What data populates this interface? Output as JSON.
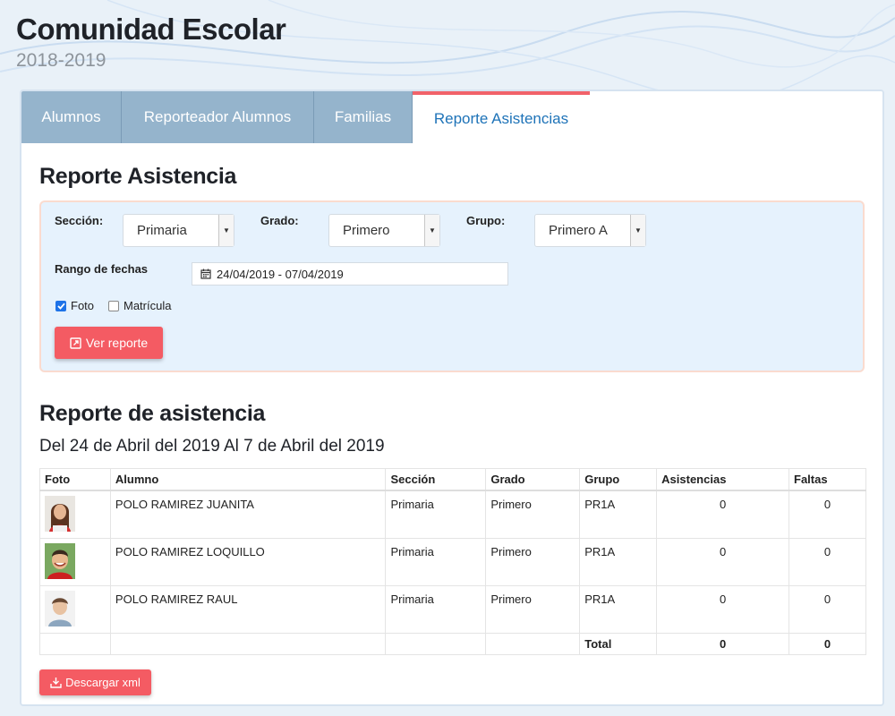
{
  "app": {
    "title": "Comunidad Escolar",
    "year": "2018-2019"
  },
  "tabs": [
    {
      "label": "Alumnos"
    },
    {
      "label": "Reporteador Alumnos"
    },
    {
      "label": "Familias"
    },
    {
      "label": "Reporte Asistencias"
    }
  ],
  "page": {
    "title": "Reporte Asistencia"
  },
  "filters": {
    "seccion": {
      "label": "Sección:",
      "value": "Primaria"
    },
    "grado": {
      "label": "Grado:",
      "value": "Primero"
    },
    "grupo": {
      "label": "Grupo:",
      "value": "Primero A"
    },
    "rango": {
      "label": "Rango de fechas",
      "value": "24/04/2019 - 07/04/2019"
    },
    "foto": {
      "label": "Foto",
      "checked": true
    },
    "matricula": {
      "label": "Matrícula",
      "checked": false
    },
    "ver_reporte": "Ver reporte"
  },
  "report": {
    "title": "Reporte de asistencia",
    "subtitle": "Del 24 de Abril del 2019 Al 7 de Abril del 2019",
    "columns": [
      "Foto",
      "Alumno",
      "Sección",
      "Grado",
      "Grupo",
      "Asistencias",
      "Faltas"
    ],
    "rows": [
      {
        "alumno": "POLO RAMIREZ JUANITA",
        "seccion": "Primaria",
        "grado": "Primero",
        "grupo": "PR1A",
        "asistencias": "0",
        "faltas": "0"
      },
      {
        "alumno": "POLO RAMIREZ LOQUILLO",
        "seccion": "Primaria",
        "grado": "Primero",
        "grupo": "PR1A",
        "asistencias": "0",
        "faltas": "0"
      },
      {
        "alumno": "POLO RAMIREZ RAUL",
        "seccion": "Primaria",
        "grado": "Primero",
        "grupo": "PR1A",
        "asistencias": "0",
        "faltas": "0"
      }
    ],
    "total": {
      "label": "Total",
      "asistencias": "0",
      "faltas": "0"
    },
    "download": "Descargar xml"
  },
  "colors": {
    "accent_red": "#f45b63",
    "tab_inactive": "#95b4cc",
    "tab_active_text": "#1e73b8",
    "filter_bg": "#e6f2fd"
  }
}
